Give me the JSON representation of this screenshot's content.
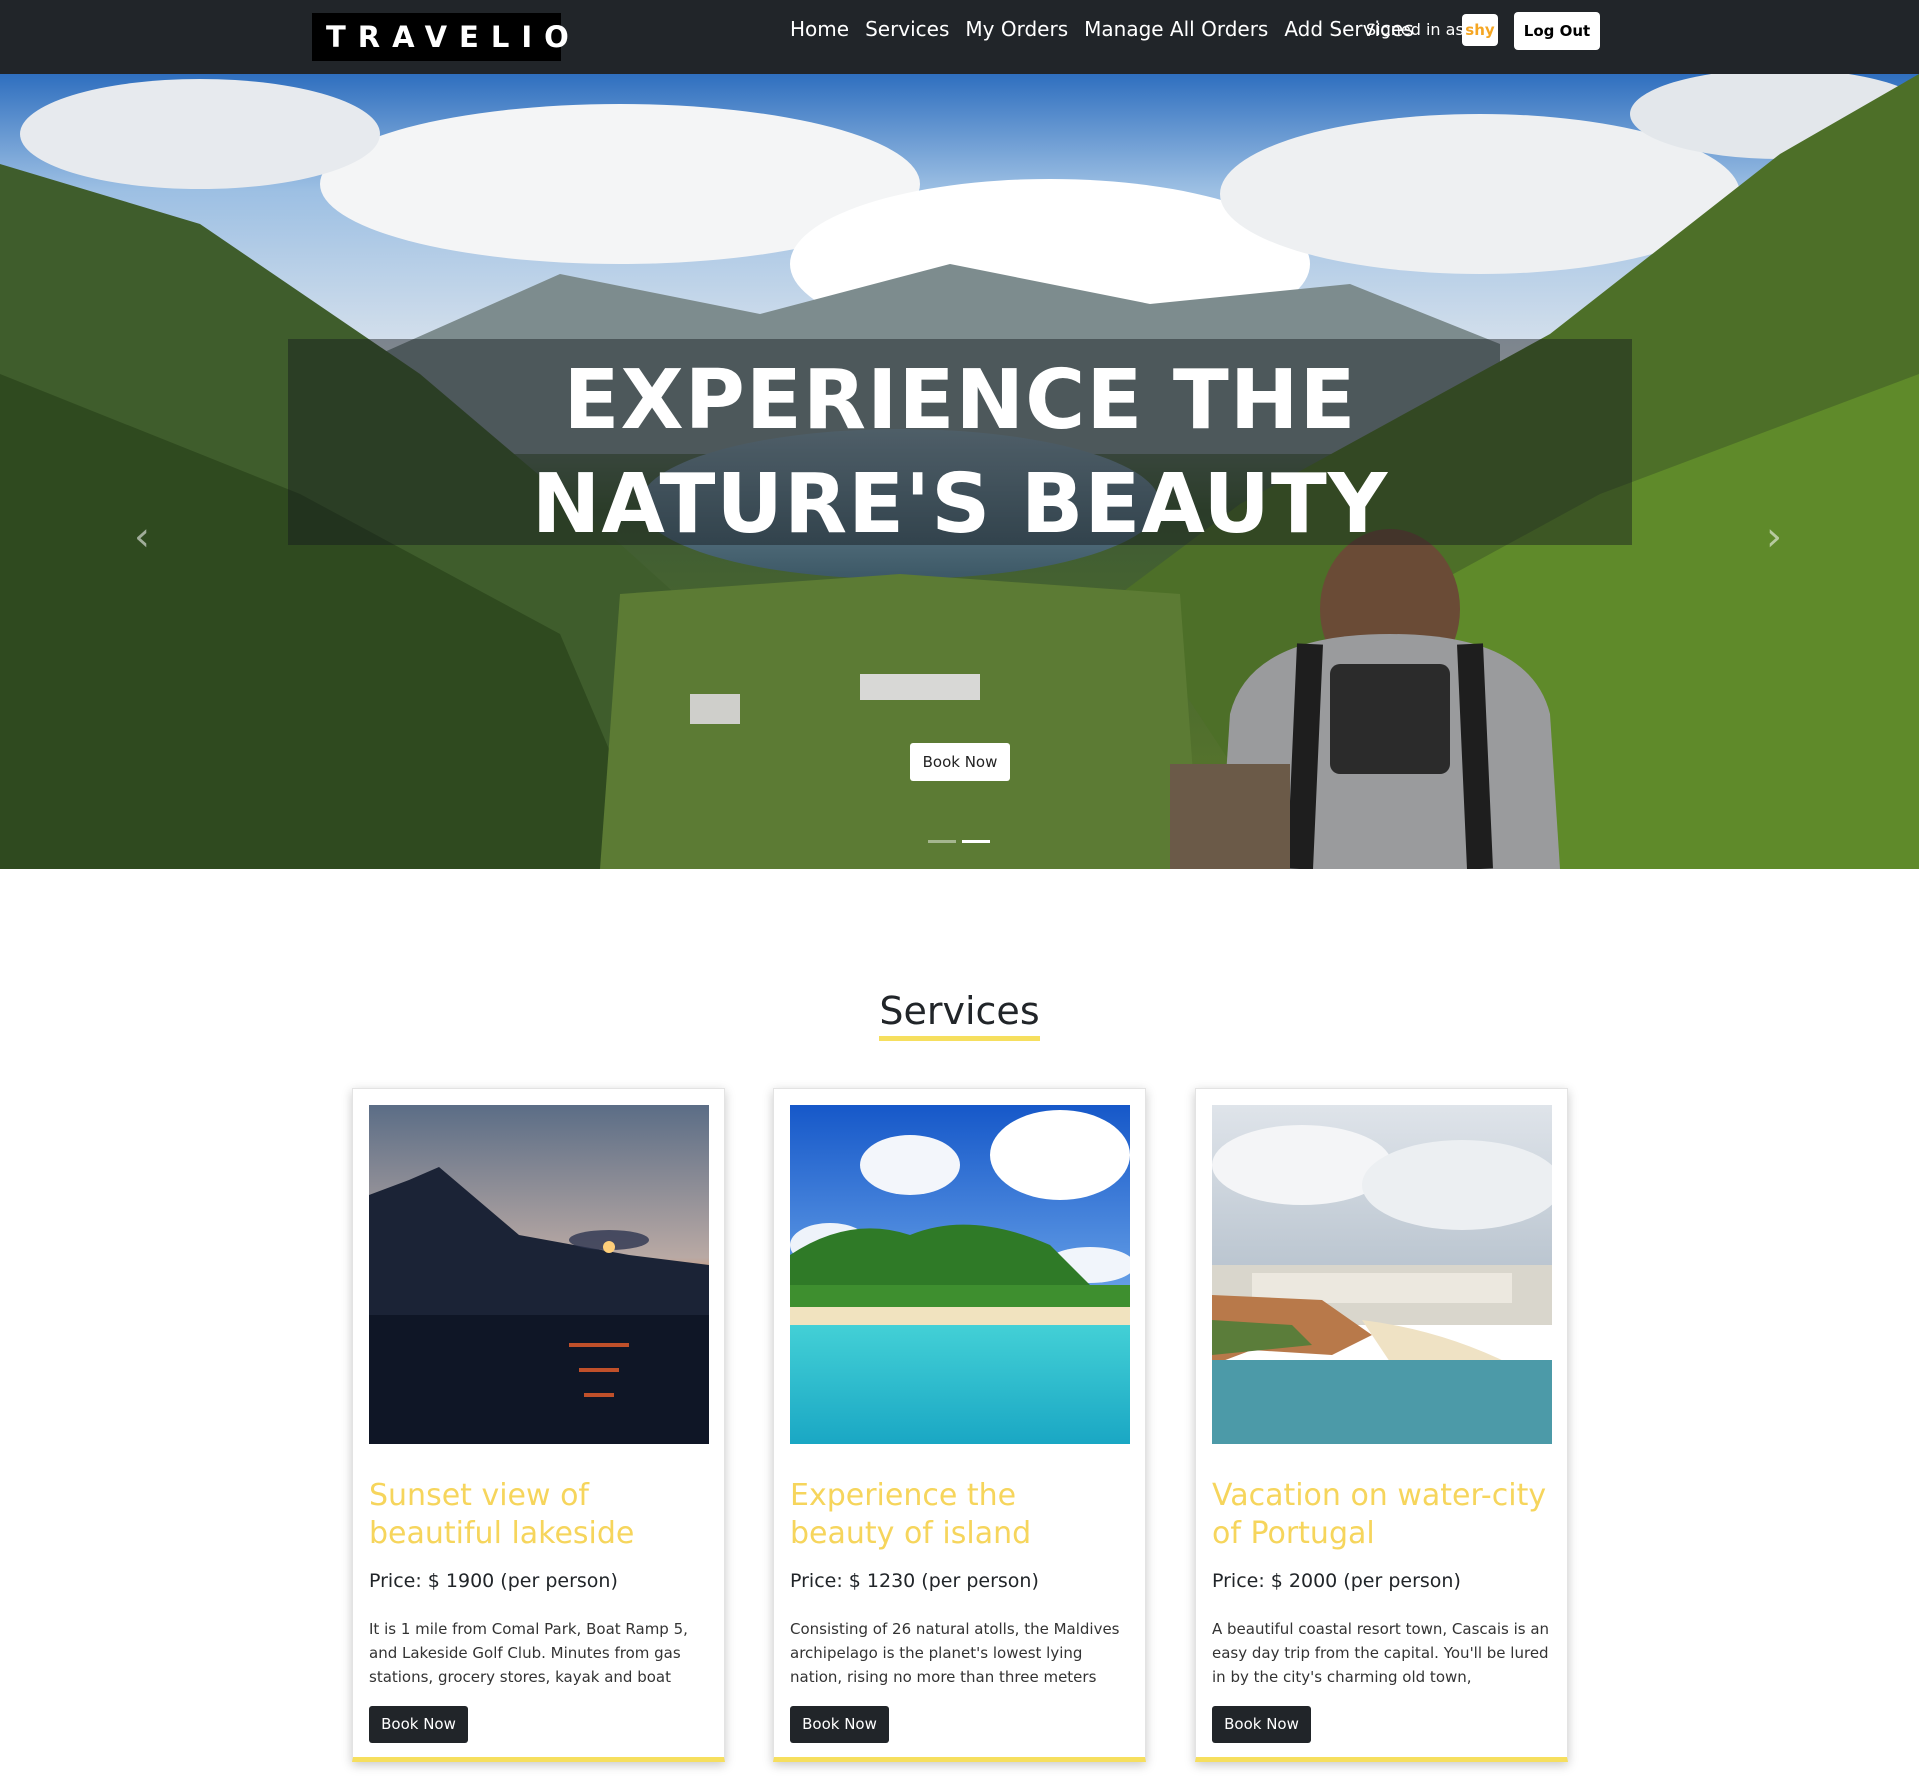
{
  "navbar": {
    "brand": "TRAVELIO",
    "links": [
      "Home",
      "Services",
      "My Orders",
      "Manage All Orders",
      "Add Services"
    ],
    "signed_in_label": "Signed in as:",
    "user": "shy",
    "logout_label": "Log Out"
  },
  "hero": {
    "title_line1": "EXPERIENCE THE",
    "title_line2": "NATURE'S BEAUTY",
    "button_label": "Book Now",
    "prev_icon": "chevron-left-icon",
    "next_icon": "chevron-right-icon",
    "active_slide": 2,
    "slide_count": 2
  },
  "services": {
    "heading": "Services",
    "cards": [
      {
        "title": "Sunset view of beautiful lakeside",
        "price": "Price: $ 1900 (per person)",
        "description": "It is 1 mile from Comal Park, Boat Ramp 5, and Lakeside Golf Club. Minutes from gas stations, grocery stores, kayak and boat",
        "button_label": "Book Now"
      },
      {
        "title": "Experience the beauty of island",
        "price": "Price: $ 1230 (per person)",
        "description": "Consisting of 26 natural atolls, the Maldives archipelago is the planet's lowest lying nation, rising no more than three meters",
        "button_label": "Book Now"
      },
      {
        "title": "Vacation on water-city of Portugal",
        "price": "Price: $ 2000 (per person)",
        "description": "A beautiful coastal resort town, Cascais is an easy day trip from the capital. You'll be lured in by the city's charming old town,",
        "button_label": "Book Now"
      }
    ]
  },
  "colors": {
    "navbar_bg": "#212529",
    "accent_yellow": "#f6df5e",
    "card_title": "#f6d55c",
    "button_dark": "#212529"
  }
}
